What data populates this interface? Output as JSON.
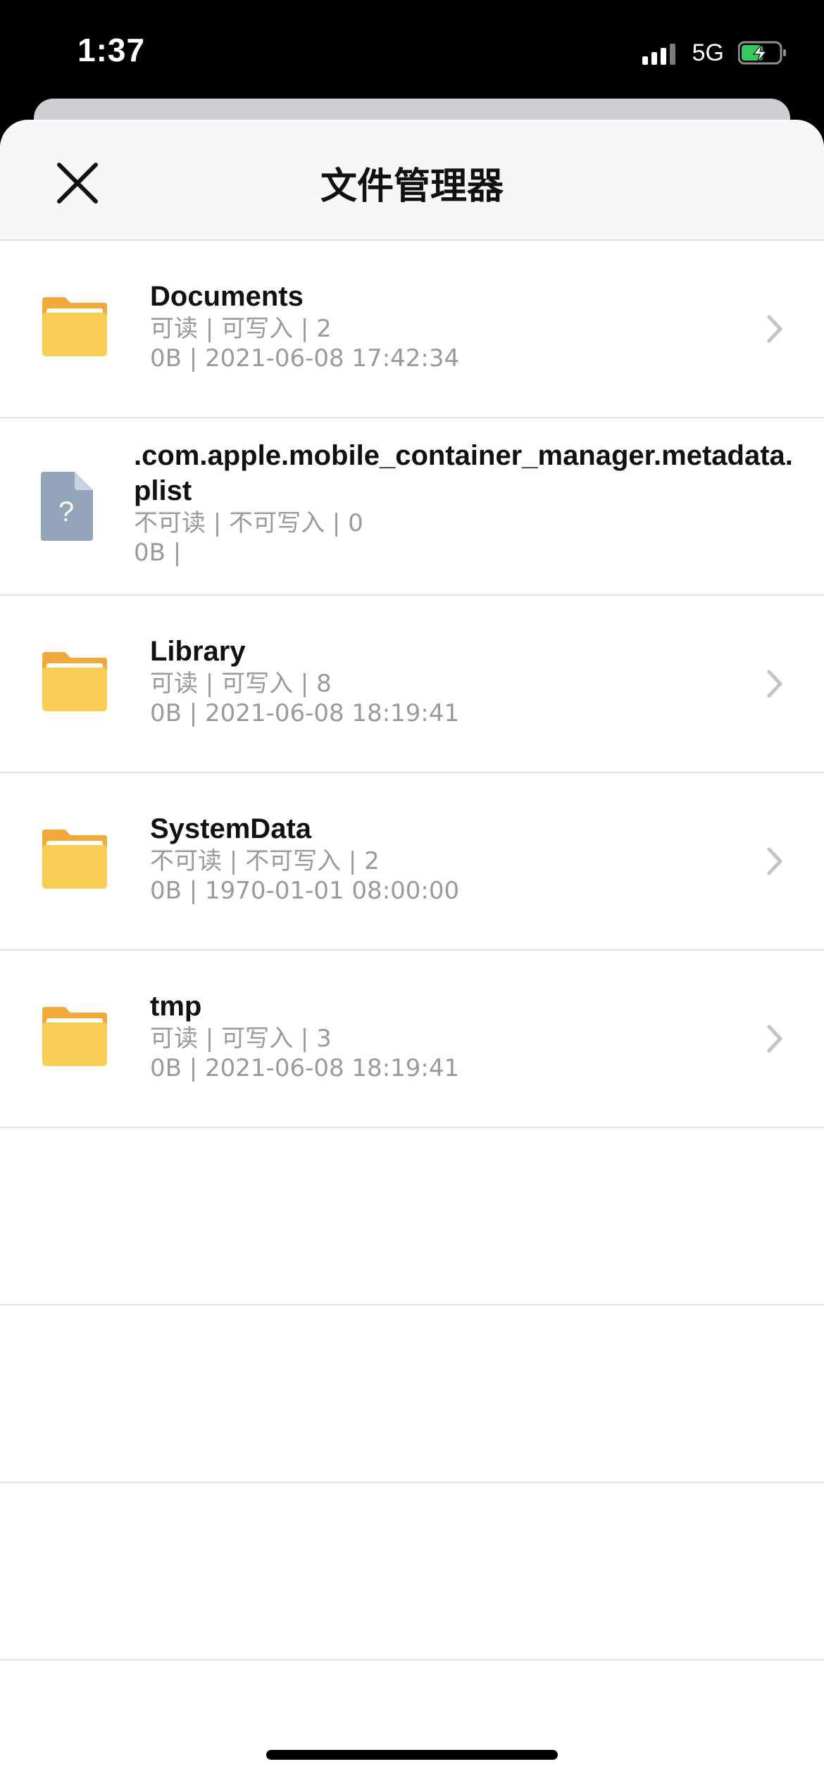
{
  "status_bar": {
    "time": "1:37",
    "network": "5G"
  },
  "nav": {
    "title": "文件管理器"
  },
  "rows": [
    {
      "type": "folder",
      "name": "Documents",
      "perm": "可读 | 可写入 | 2",
      "info": "0B | 2021-06-08 17:42:34"
    },
    {
      "type": "file",
      "name": ".com.apple.mobile_container_manager.metadata.plist",
      "perm": "不可读 | 不可写入 | 0",
      "info": "0B |"
    },
    {
      "type": "folder",
      "name": "Library",
      "perm": "可读 | 可写入 | 8",
      "info": "0B | 2021-06-08 18:19:41"
    },
    {
      "type": "folder",
      "name": "SystemData",
      "perm": "不可读 | 不可写入 | 2",
      "info": "0B | 1970-01-01 08:00:00"
    },
    {
      "type": "folder",
      "name": "tmp",
      "perm": "可读 | 可写入 | 3",
      "info": "0B | 2021-06-08 18:19:41"
    }
  ],
  "colors": {
    "folder_back": "#f2a93b",
    "folder_front": "#f7cd55",
    "file_icon": "#94a5bb"
  }
}
